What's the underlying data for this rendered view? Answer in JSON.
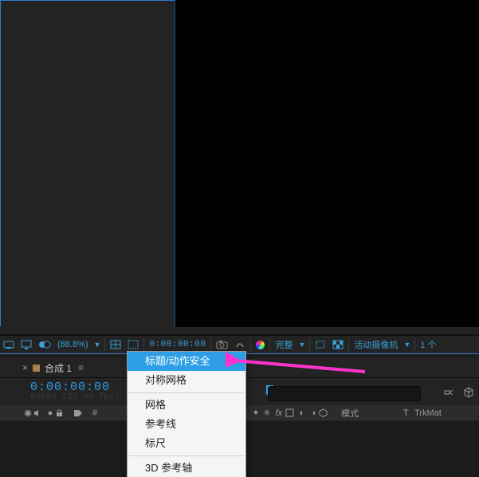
{
  "viewer_controls": {
    "zoom": "(88.8%)",
    "timecode": "0:00:00:00",
    "resolution": "完整",
    "camera": "活动摄像机",
    "views": "1 个"
  },
  "timeline": {
    "tab_name": "合成 1",
    "timecode": "0:00:00:00",
    "fps_label": "00000 (25.00 fps)",
    "col_hash": "#",
    "col_mode": "模式",
    "col_trk_t": "T",
    "col_trk": "TrkMat"
  },
  "context_menu": {
    "items": [
      "标题/动作安全",
      "对称网格",
      "网格",
      "参考线",
      "标尺",
      "3D 参考轴"
    ]
  }
}
